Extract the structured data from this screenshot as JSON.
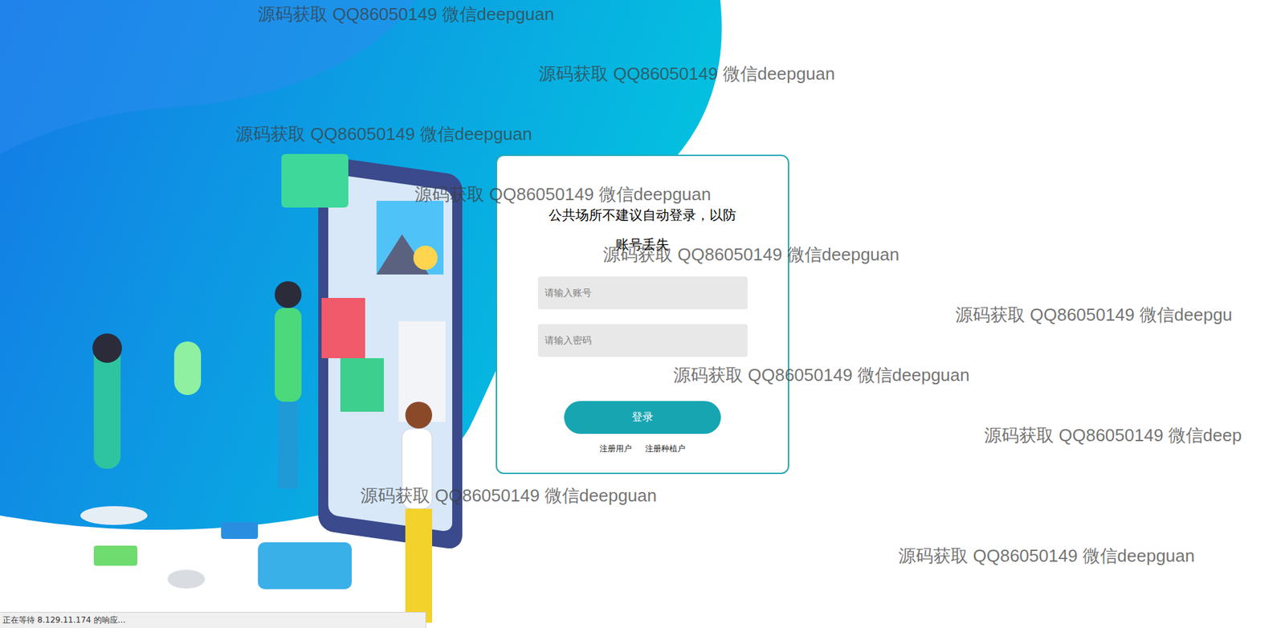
{
  "login_form": {
    "notice": "公共场所不建议自动登录，以防账号丢失",
    "fields": [
      {
        "placeholder": "请输入账号",
        "kind": "text"
      },
      {
        "placeholder": "请输入密码",
        "kind": "password"
      }
    ],
    "submit": "登录",
    "links": [
      "注册用户",
      "注册种植户"
    ]
  },
  "watermarks": [
    "源码获取 QQ86050149 微信deepguan",
    "源码获取 QQ86050149 微信deepguan",
    "源码获取 QQ86050149 微信deepguan",
    "源码获取 QQ86050149 微信deepguan",
    "源码获取 QQ86050149 微信deepguan",
    "源码获取 QQ86050149 微信deepgu",
    "源码获取 QQ86050149 微信deepguan",
    "源码获取 QQ86050149 微信deep",
    "源码获取 QQ86050149 微信deepguan",
    "源码获取 QQ86050149 微信deepguan"
  ],
  "status_bar": "正在等待 8.129.11.174 的响应..."
}
